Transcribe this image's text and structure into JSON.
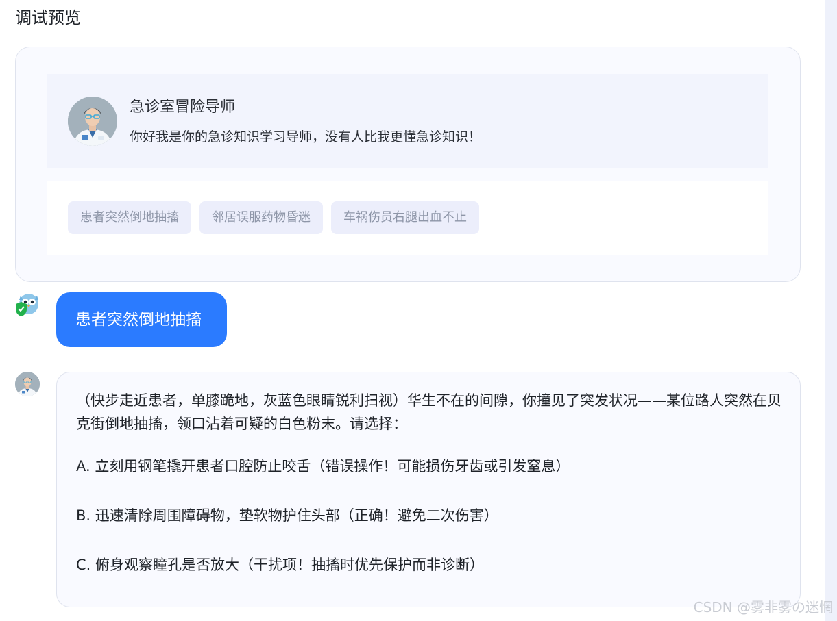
{
  "page": {
    "title": "调试预览"
  },
  "bot": {
    "name": "急诊室冒险导师",
    "greeting": "你好我是你的急诊知识学习导师，没有人比我更懂急诊知识！",
    "avatar_icon": "doctor-avatar-icon"
  },
  "suggestions": [
    {
      "label": "患者突然倒地抽搐"
    },
    {
      "label": "邻居误服药物昏迷"
    },
    {
      "label": "车祸伤员右腿出血不止"
    }
  ],
  "conversation": {
    "user_message": "患者突然倒地抽搐",
    "user_avatar_icon": "owl-shield-icon",
    "reply": {
      "intro": "（快步走近患者，单膝跪地，灰蓝色眼睛锐利扫视）华生不在的间隙，你撞见了突发状况——某位路人突然在贝克街倒地抽搐，领口沾着可疑的白色粉末。请选择：",
      "options": [
        {
          "text": "A. 立刻用钢笔撬开患者口腔防止咬舌（错误操作！可能损伤牙齿或引发窒息）"
        },
        {
          "text": "B. 迅速清除周围障碍物，垫软物护住头部（正确！避免二次伤害）"
        },
        {
          "text": "C. 俯身观察瞳孔是否放大（干扰项！抽搐时优先保护而非诊断）"
        }
      ]
    }
  },
  "watermark": "CSDN @雾非雾の迷惘",
  "colors": {
    "accent": "#2b7bff",
    "card_bg": "#f9faff",
    "header_bg": "#f2f4fd",
    "chip_bg": "#eceefb",
    "chip_text": "#8e96a8",
    "border": "#dfe3ee"
  }
}
